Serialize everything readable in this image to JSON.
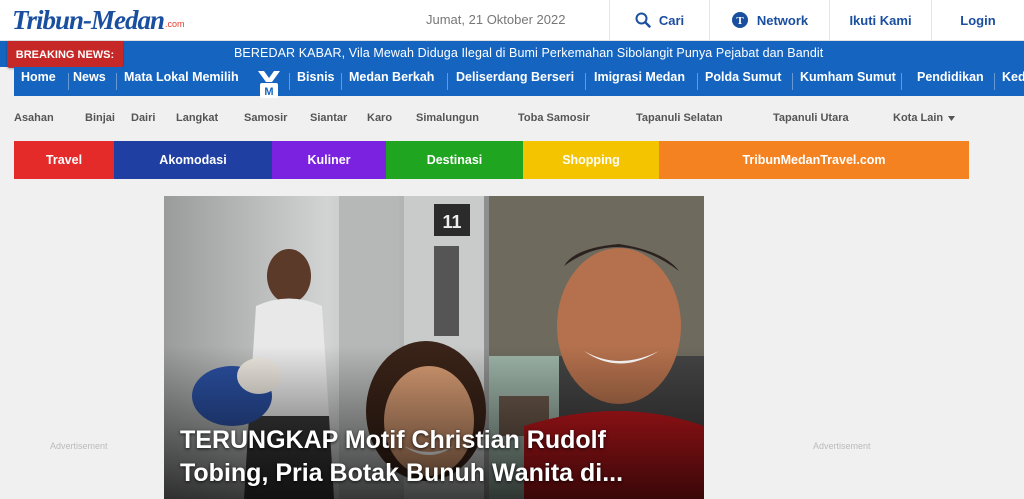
{
  "header": {
    "logo_text": "Tribun-Medan",
    "logo_suffix": ".com",
    "date": "Jumat, 21 Oktober 2022",
    "nav": {
      "search_label": "Cari",
      "network_label": "Network",
      "follow_label": "Ikuti Kami",
      "login_label": "Login"
    }
  },
  "ticker": {
    "badge": "BREAKING NEWS:",
    "headline": "BEREDAR KABAR, Vila Mewah Diduga Ilegal di Bumi Perkemahan Sibolangit Punya Pejabat dan Bandit"
  },
  "main_nav": {
    "items": [
      "Home",
      "News",
      "Mata Lokal Memilih",
      "Bisnis",
      "Medan Berkah",
      "Deliserdang Berseri",
      "Imigrasi Medan",
      "Polda Sumut",
      "Kumham Sumut",
      "Pendidikan",
      "Ked"
    ]
  },
  "sub_nav": {
    "items": [
      "Asahan",
      "Binjai",
      "Dairi",
      "Langkat",
      "Samosir",
      "Siantar",
      "Karo",
      "Simalungun",
      "Toba Samosir",
      "Tapanuli Selatan",
      "Tapanuli Utara",
      "Kota Lain"
    ],
    "more_icon": "caret-down-icon"
  },
  "color_bar": {
    "items": [
      {
        "label": "Travel",
        "color": "#e52a2a"
      },
      {
        "label": "Akomodasi",
        "color": "#1f3fa3"
      },
      {
        "label": "Kuliner",
        "color": "#7b22e0"
      },
      {
        "label": "Destinasi",
        "color": "#1fa51f"
      },
      {
        "label": "Shopping",
        "color": "#f5c400"
      },
      {
        "label": "TribunMedanTravel.com",
        "color": "#f58220"
      }
    ]
  },
  "hero": {
    "title_line1": "TERUNGKAP Motif Christian Rudolf",
    "title_line2": "Tobing, Pria Botak Bunuh Wanita di..."
  },
  "ads": {
    "left_label": "Advertisement",
    "right_label": "Advertisement"
  },
  "colors": {
    "brand_blue": "#1565c0",
    "breaking_red": "#c62828",
    "logo_blue": "#1a4fa0"
  }
}
